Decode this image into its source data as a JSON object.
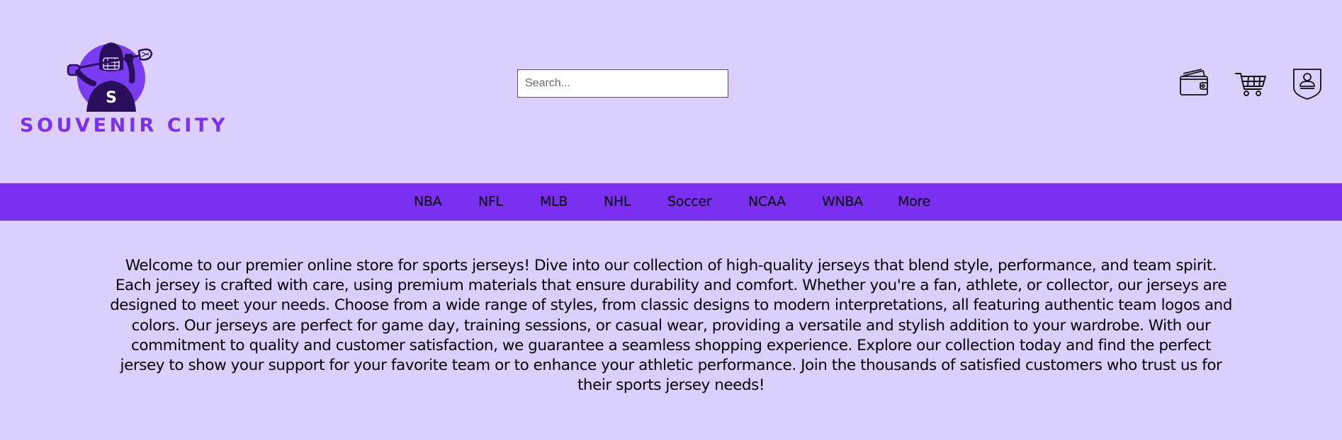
{
  "brand": {
    "name": "SOUVENIR CITY",
    "shirt_letter": "S"
  },
  "search": {
    "placeholder": "Search...",
    "value": ""
  },
  "header_icons": [
    {
      "name": "wallet-icon"
    },
    {
      "name": "cart-icon"
    },
    {
      "name": "account-shield-icon"
    }
  ],
  "nav": {
    "items": [
      {
        "label": "NBA"
      },
      {
        "label": "NFL"
      },
      {
        "label": "MLB"
      },
      {
        "label": "NHL"
      },
      {
        "label": "Soccer"
      },
      {
        "label": "NCAA"
      },
      {
        "label": "WNBA"
      },
      {
        "label": "More"
      }
    ]
  },
  "intro": {
    "text": "Welcome to our premier online store for sports jerseys! Dive into our collection of high-quality jerseys that blend style, performance, and team spirit. Each jersey is crafted with care, using premium materials that ensure durability and comfort. Whether you're a fan, athlete, or collector, our jerseys are designed to meet your needs. Choose from a wide range of styles, from classic designs to modern interpretations, all featuring authentic team logos and colors. Our jerseys are perfect for game day, training sessions, or casual wear, providing a versatile and stylish addition to your wardrobe. With our commitment to quality and customer satisfaction, we guarantee a seamless shopping experience. Explore our collection today and find the perfect jersey to show your support for your favorite team or to enhance your athletic performance. Join the thousands of satisfied customers who trust us for their sports jersey needs!"
  },
  "colors": {
    "background": "#dccfff",
    "accent": "#7b2ff0",
    "logo_dark": "#2a0f5c",
    "logo_circle": "#7a3cf0"
  }
}
